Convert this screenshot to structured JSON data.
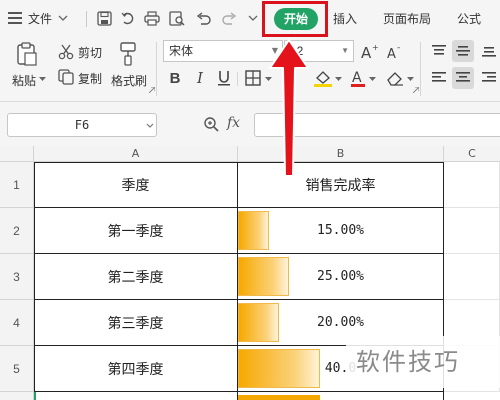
{
  "menubar": {
    "file_label": "文件",
    "tabs": [
      "开始",
      "插入",
      "页面布局",
      "公式"
    ]
  },
  "ribbon": {
    "paste_label": "粘贴",
    "cut_label": "剪切",
    "copy_label": "复制",
    "format_painter_label": "格式刷",
    "font_name": "宋体",
    "font_size": "12"
  },
  "formula_bar": {
    "cell_ref": "F6",
    "fx_label": "fx",
    "formula": ""
  },
  "grid": {
    "columns": [
      "A",
      "B",
      "C"
    ],
    "rows": [
      "1",
      "2",
      "3",
      "4",
      "5"
    ],
    "header": [
      "季度",
      "销售完成率"
    ],
    "data": [
      {
        "quarter": "第一季度",
        "rate_text": "15.00%",
        "rate": 0.15
      },
      {
        "quarter": "第二季度",
        "rate_text": "25.00%",
        "rate": 0.25
      },
      {
        "quarter": "第三季度",
        "rate_text": "20.00%",
        "rate": 0.2
      },
      {
        "quarter": "第四季度",
        "rate_text": "40.0",
        "rate": 0.4
      }
    ]
  },
  "watermark": "软件技巧",
  "colors": {
    "accent_green": "#21a366",
    "highlight_red": "#d9121b",
    "bar_orange": "#f6a800"
  }
}
